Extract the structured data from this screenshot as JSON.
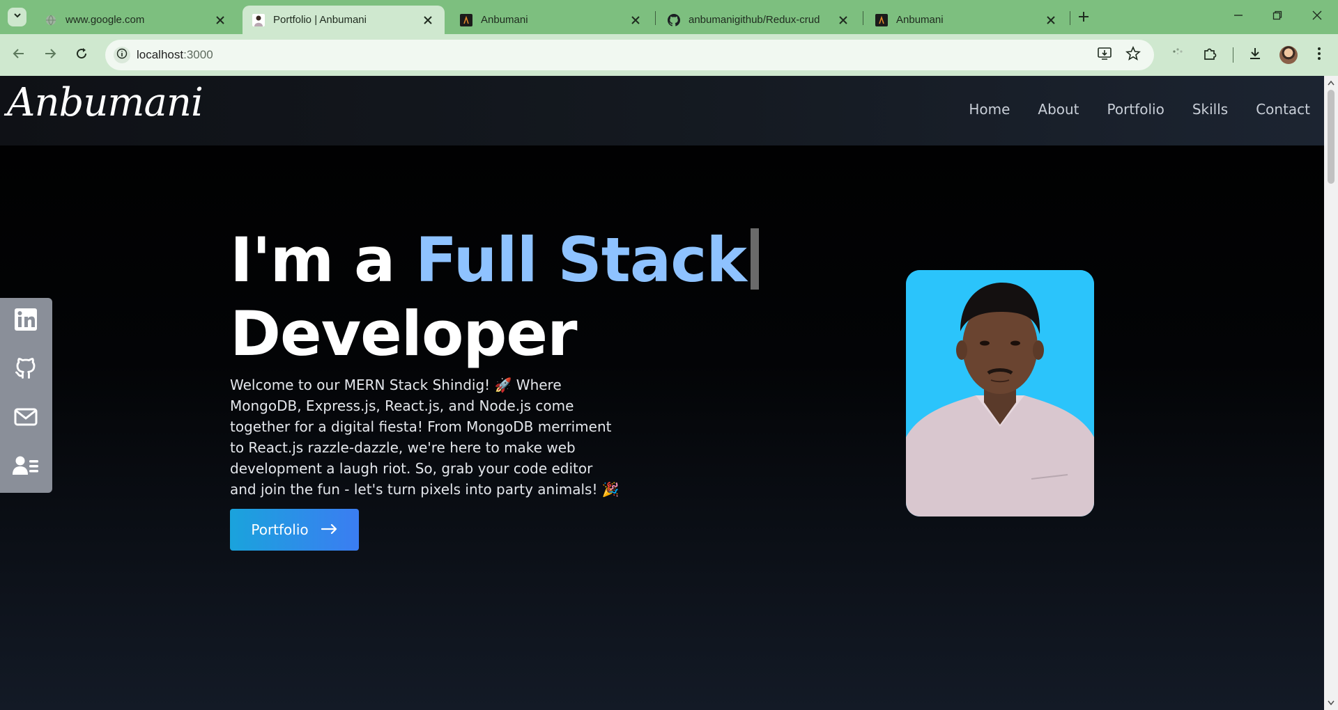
{
  "browser": {
    "tabs": [
      {
        "title": "www.google.com",
        "favicon": "globe-icon",
        "active": false
      },
      {
        "title": "Portfolio | Anbumani",
        "favicon": "portrait-favicon",
        "active": true
      },
      {
        "title": "Anbumani",
        "favicon": "dark-a-favicon",
        "active": false
      },
      {
        "title": "anbumanigithub/Redux-crud",
        "favicon": "github-icon",
        "active": false
      },
      {
        "title": "Anbumani",
        "favicon": "dark-a-favicon",
        "active": false
      }
    ],
    "url_host": "localhost",
    "url_port": ":3000",
    "colors": {
      "tabstrip": "#7dbf7f",
      "toolbar": "#cfe8cf"
    }
  },
  "site": {
    "logo": "Anbumani",
    "nav": [
      "Home",
      "About",
      "Portfolio",
      "Skills",
      "Contact"
    ],
    "hero": {
      "title_prefix": "I'm a ",
      "title_accent": "Full Stack",
      "title_line2": "Developer",
      "description": "Welcome to our MERN Stack Shindig! 🚀 Where MongoDB, Express.js, React.js, and Node.js come together for a digital fiesta! From MongoDB merriment to React.js razzle-dazzle, we're here to make web development a laugh riot. So, grab your code editor and join the fun - let's turn pixels into party animals! 🎉",
      "cta_label": "Portfolio"
    },
    "social": [
      "linkedin-icon",
      "github-icon",
      "mail-icon",
      "contact-card-icon"
    ],
    "colors": {
      "accent": "#8ec2ff",
      "cta_start": "#1aa3dc",
      "cta_end": "#3b7df2",
      "photo_bg": "#2bc4fb"
    }
  }
}
